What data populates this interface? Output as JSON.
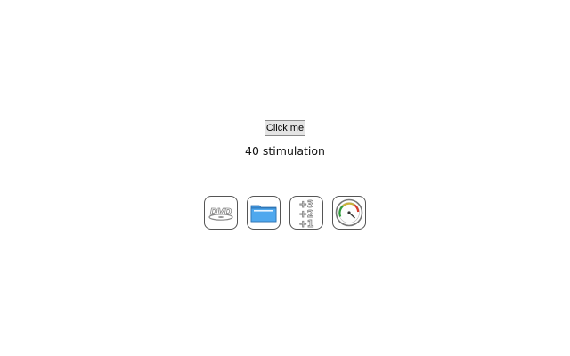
{
  "button": {
    "label": "Click me"
  },
  "status": {
    "text": "40 stimulation"
  },
  "icons": [
    {
      "name": "dvd-icon",
      "logo_text": "DVD"
    },
    {
      "name": "folder-icon"
    },
    {
      "name": "plus-counter-icon",
      "lines": [
        "+3",
        "+2",
        "+1"
      ]
    },
    {
      "name": "speedometer-icon"
    }
  ],
  "colors": {
    "folder": "#4fa8ee",
    "gauge_green": "#2e9b3a",
    "gauge_red": "#d63a2a"
  }
}
